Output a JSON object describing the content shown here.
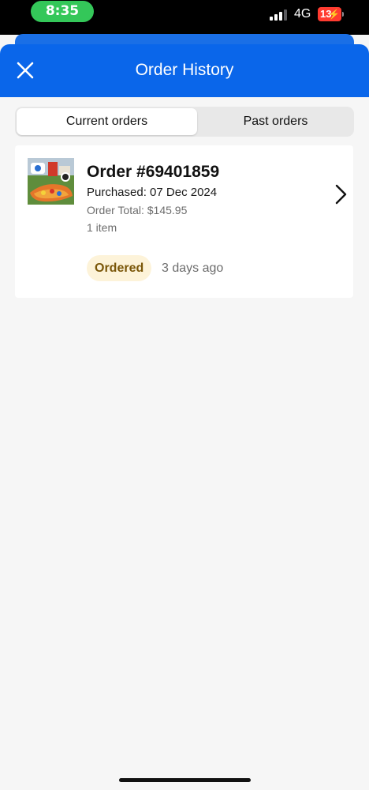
{
  "status_bar": {
    "time": "8:35",
    "network": "4G",
    "battery": "13"
  },
  "header": {
    "title": "Order History",
    "close_icon": "close-icon",
    "color": "#0a66ea"
  },
  "tabs": [
    {
      "label": "Current orders",
      "active": true
    },
    {
      "label": "Past orders",
      "active": false
    }
  ],
  "order": {
    "number": "Order #69401859",
    "purchased": "Purchased: 07 Dec 2024",
    "total": "Order Total: $145.95",
    "items": "1 item",
    "status": "Ordered",
    "status_time": "3 days ago",
    "chevron_icon": "chevron-right-icon",
    "status_color": "#fdf3d9"
  }
}
